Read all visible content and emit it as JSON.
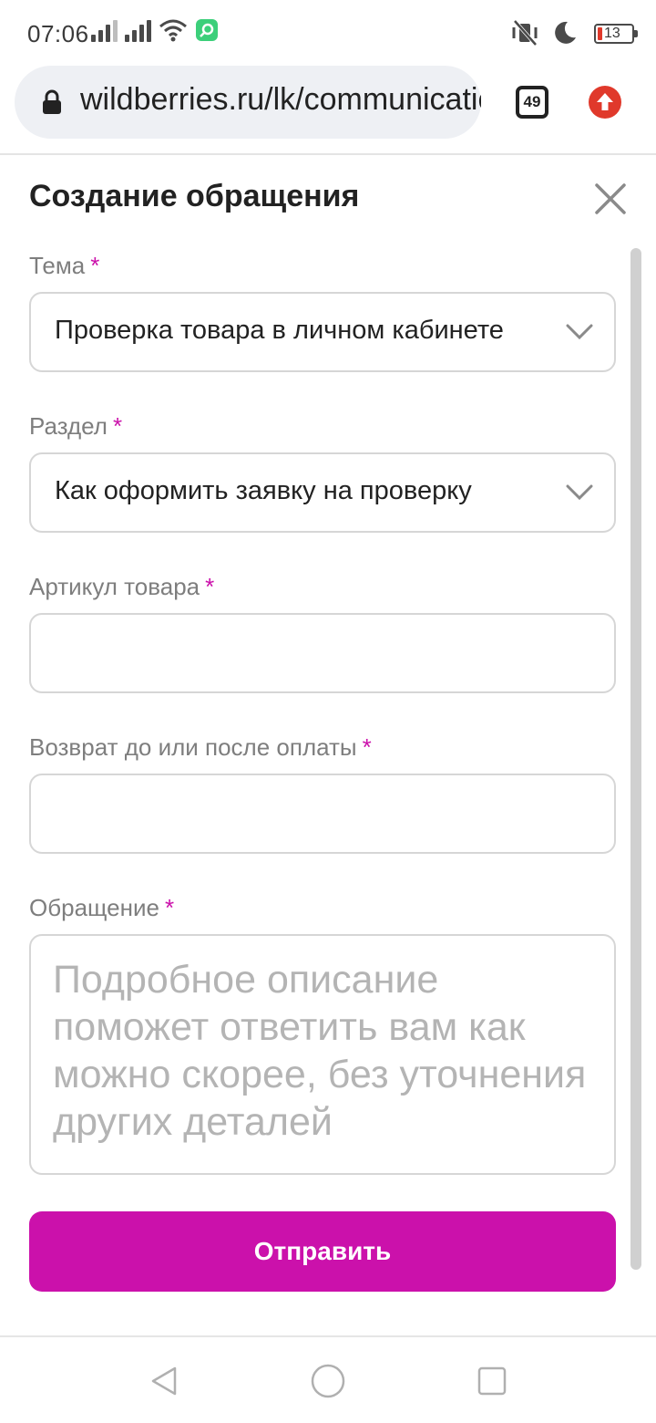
{
  "status_bar": {
    "time": "07:06",
    "battery": "13",
    "colors": {
      "icon": "#4a4a4a",
      "battery_low": "#e0392b",
      "app_badge": "#3ccf7a"
    },
    "icons": [
      "signal-icon",
      "signal-icon",
      "wifi-icon",
      "app-notification-icon",
      "vibrate-off-icon",
      "do-not-disturb-icon",
      "battery-icon"
    ]
  },
  "browser": {
    "url": "wildberries.ru/lk/communications",
    "tabs_count": "49",
    "icons": [
      "lock-icon",
      "tabs-icon",
      "update-icon"
    ],
    "update_color": "#e0392b"
  },
  "form": {
    "title": "Создание обращения",
    "required_mark": "*",
    "accent_color": "#cb11ab",
    "fields": [
      {
        "label": "Тема",
        "value": "Проверка товара в личном кабинете"
      },
      {
        "label": "Раздел",
        "value": "Как оформить заявку на проверку"
      },
      {
        "label": "Артикул товара",
        "value": ""
      },
      {
        "label": "Возврат до или после оплаты",
        "value": ""
      }
    ],
    "message": {
      "label": "Обращение",
      "placeholder": "Подробное описание поможет ответить вам как можно скорее, без уточнения других деталей"
    },
    "submit_label": "Отправить"
  },
  "nav_bar": {
    "icons": [
      "back-icon",
      "home-icon",
      "recents-icon"
    ]
  }
}
